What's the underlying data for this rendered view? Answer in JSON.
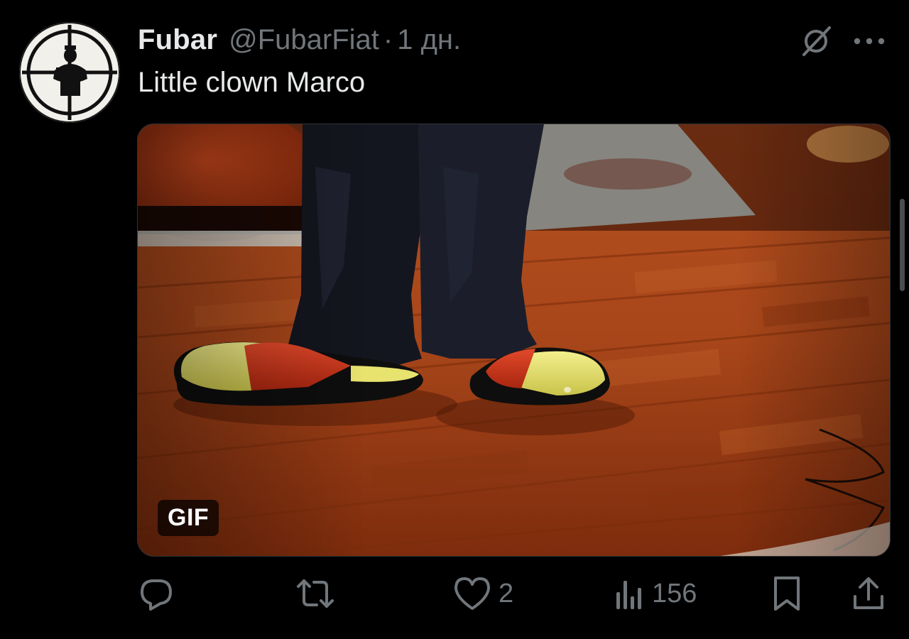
{
  "author": {
    "display_name": "Fubar",
    "handle": "@FubarFiat",
    "separator": "·",
    "time": "1 дн."
  },
  "tweet": {
    "text": "Little clown Marco"
  },
  "media": {
    "type_badge": "GIF",
    "description_icon": "gif-media"
  },
  "actions": {
    "reply": {
      "icon": "reply-icon",
      "count": ""
    },
    "retweet": {
      "icon": "retweet-icon",
      "count": ""
    },
    "like": {
      "icon": "heart-icon",
      "count": "2"
    },
    "views": {
      "icon": "views-icon",
      "count": "156"
    },
    "bookmark": {
      "icon": "bookmark-icon"
    },
    "share": {
      "icon": "share-icon"
    }
  },
  "colors": {
    "background": "#000000",
    "primary_text": "#e7e9ea",
    "secondary_text": "#71767b"
  }
}
